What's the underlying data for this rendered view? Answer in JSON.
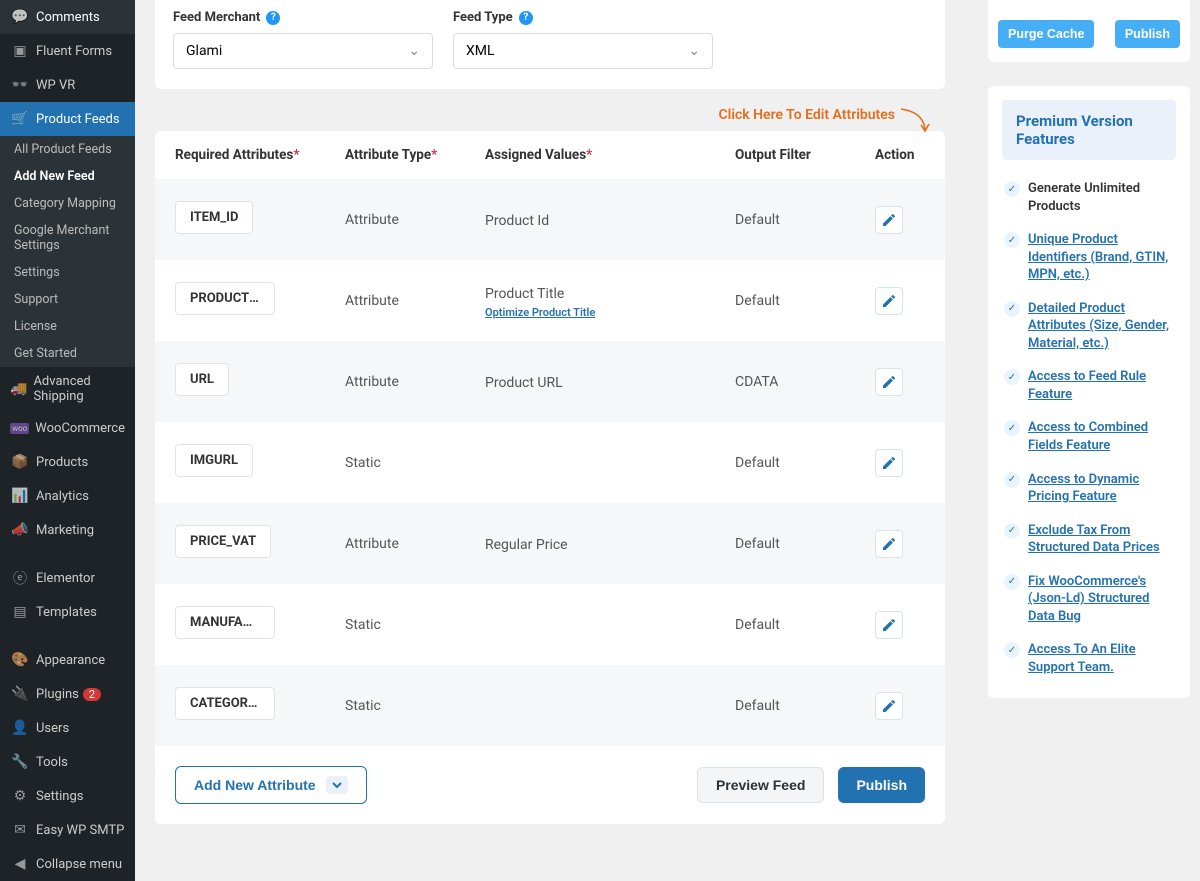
{
  "sidebar": {
    "items": [
      {
        "label": "Comments"
      },
      {
        "label": "Fluent Forms"
      },
      {
        "label": "WP VR"
      },
      {
        "label": "Product Feeds",
        "active": true
      },
      {
        "label": "Advanced Shipping"
      },
      {
        "label": "WooCommerce"
      },
      {
        "label": "Products"
      },
      {
        "label": "Analytics"
      },
      {
        "label": "Marketing"
      },
      {
        "label": "Elementor"
      },
      {
        "label": "Templates"
      },
      {
        "label": "Appearance"
      },
      {
        "label": "Plugins",
        "badge": "2"
      },
      {
        "label": "Users"
      },
      {
        "label": "Tools"
      },
      {
        "label": "Settings"
      },
      {
        "label": "Easy WP SMTP"
      },
      {
        "label": "Collapse menu"
      }
    ],
    "sub_feeds": [
      {
        "label": "All Product Feeds"
      },
      {
        "label": "Add New Feed",
        "active": true
      },
      {
        "label": "Category Mapping"
      },
      {
        "label": "Google Merchant Settings"
      },
      {
        "label": "Settings"
      },
      {
        "label": "Support"
      },
      {
        "label": "License"
      },
      {
        "label": "Get Started"
      }
    ]
  },
  "fields": {
    "merchant": {
      "label": "Feed Merchant",
      "value": "Glami"
    },
    "type": {
      "label": "Feed Type",
      "value": "XML"
    }
  },
  "edit_attributes_text": "Click Here To Edit Attributes",
  "table": {
    "headers": {
      "req": "Required Attributes",
      "atype": "Attribute Type",
      "assigned": "Assigned Values",
      "filter": "Output Filter",
      "action": "Action"
    },
    "rows": [
      {
        "name": "ITEM_ID",
        "type": "Attribute",
        "assigned": "Product Id",
        "filter": "Default"
      },
      {
        "name": "PRODUCTNAME",
        "display_name": "PRODUCTNA...",
        "type": "Attribute",
        "assigned": "Product Title",
        "optimize": "Optimize Product Title",
        "filter": "Default"
      },
      {
        "name": "URL",
        "type": "Attribute",
        "assigned": "Product URL",
        "filter": "CDATA"
      },
      {
        "name": "IMGURL",
        "type": "Static",
        "assigned": "",
        "filter": "Default"
      },
      {
        "name": "PRICE_VAT",
        "type": "Attribute",
        "assigned": "Regular Price",
        "filter": "Default"
      },
      {
        "name": "MANUFACTURER",
        "display_name": "MANUFACTU...",
        "type": "Static",
        "assigned": "",
        "filter": "Default"
      },
      {
        "name": "CATEGORYTEXT",
        "display_name": "CATEGORYT...",
        "type": "Static",
        "assigned": "",
        "filter": "Default"
      }
    ]
  },
  "buttons": {
    "add_attribute": "Add New Attribute",
    "preview": "Preview Feed",
    "publish": "Publish",
    "purge_cache": "Purge Cache",
    "publish_side": "Publish"
  },
  "premium": {
    "title": "Premium Version Features",
    "items": [
      {
        "text": "Generate Unlimited Products",
        "plain": true
      },
      {
        "text": "Unique Product Identifiers (Brand, GTIN, MPN, etc.)"
      },
      {
        "text": "Detailed Product Attributes (Size, Gender, Material, etc.)"
      },
      {
        "text": "Access to Feed Rule Feature"
      },
      {
        "text": "Access to Combined Fields Feature"
      },
      {
        "text": "Access to Dynamic Pricing Feature"
      },
      {
        "text": "Exclude Tax From Structured Data Prices"
      },
      {
        "text": "Fix WooCommerce's (Json-Ld) Structured Data Bug"
      },
      {
        "text": "Access To An Elite Support Team."
      }
    ]
  }
}
